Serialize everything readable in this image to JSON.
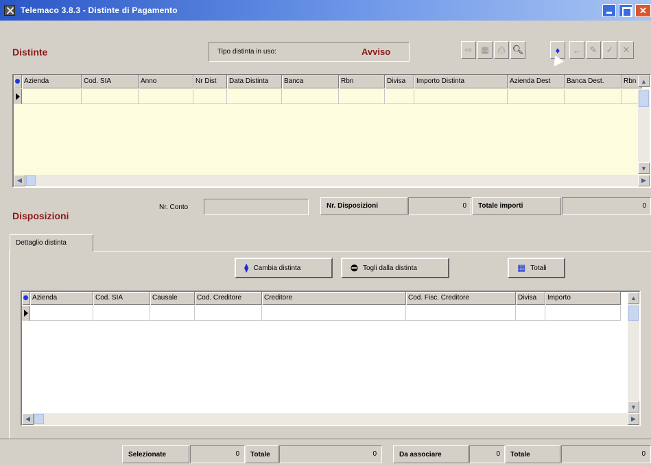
{
  "window": {
    "title": "Telemaco 3.8.3  - Distinte di Pagamento",
    "buttons": {
      "minimize": "minimize",
      "maximize": "maximize",
      "close": "close"
    }
  },
  "distinte": {
    "title": "Distinte",
    "tipo_label": "Tipo distinta in uso:",
    "tipo_value": "Avviso",
    "toolbar": [
      {
        "name": "export-icon",
        "enabled": false
      },
      {
        "name": "grid-icon",
        "enabled": false
      },
      {
        "name": "print-icon",
        "enabled": false
      },
      {
        "name": "zoom-icon",
        "enabled": true
      },
      {
        "name": "new-record-icon",
        "enabled": true
      },
      {
        "name": "arrow-left-icon",
        "enabled": false
      },
      {
        "name": "edit-icon",
        "enabled": false
      },
      {
        "name": "confirm-icon",
        "enabled": false
      },
      {
        "name": "cancel-icon",
        "enabled": false
      }
    ],
    "columns": [
      "Azienda",
      "Cod. SIA",
      "Anno",
      "Nr Dist",
      "Data Distinta",
      "Banca",
      "Rbn",
      "Divisa",
      "Importo Distinta",
      "Azienda Dest",
      "Banca Dest.",
      "Rbn"
    ]
  },
  "disposizioni": {
    "title": "Disposizioni",
    "nr_conto_label": "Nr. Conto",
    "nr_conto_value": "",
    "nr_disposizioni_label": "Nr. Disposizioni",
    "nr_disposizioni_value": "0",
    "totale_importi_label": "Totale importi",
    "totale_importi_value": "0",
    "tab": "Dettaglio distinta",
    "buttons": {
      "cambia": "Cambia distinta",
      "togli": "Togli dalla distinta",
      "totali": "Totali"
    },
    "columns": [
      "Azienda",
      "Cod. SIA",
      "Causale",
      "Cod. Creditore",
      "Creditore",
      "Cod. Fisc. Creditore",
      "Divisa",
      "Importo"
    ]
  },
  "footer": {
    "selezionate_label": "Selezionate",
    "selezionate_value": "0",
    "totale1_label": "Totale",
    "totale1_value": "0",
    "da_associare_label": "Da associare",
    "da_associare_value": "0",
    "totale2_label": "Totale",
    "totale2_value": "0"
  }
}
